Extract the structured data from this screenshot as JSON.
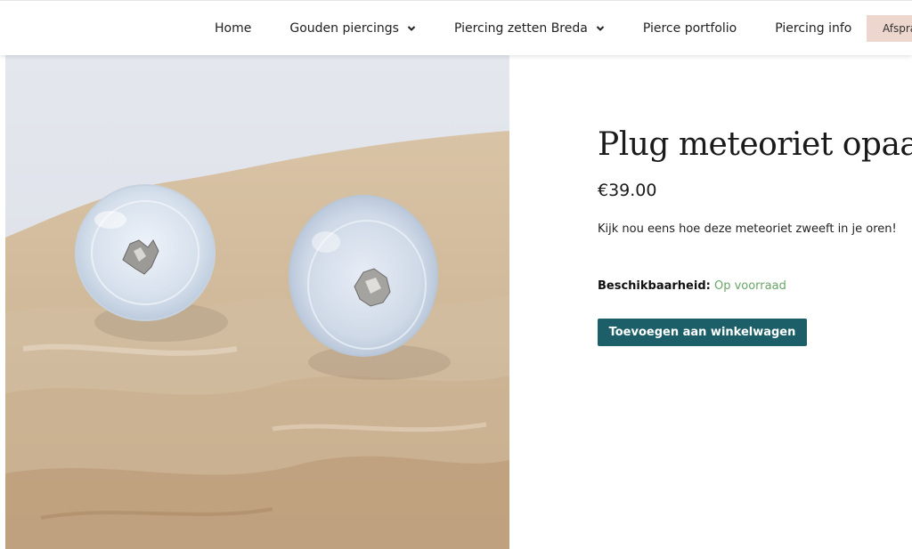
{
  "nav": {
    "items": [
      {
        "label": "Home",
        "dropdown": false
      },
      {
        "label": "Gouden piercings",
        "dropdown": true
      },
      {
        "label": "Piercing zetten Breda",
        "dropdown": true
      },
      {
        "label": "Pierce portfolio",
        "dropdown": false
      },
      {
        "label": "Piercing info",
        "dropdown": false
      }
    ],
    "cta_label": "Afspraak"
  },
  "product": {
    "title": "Plug meteoriet opaal",
    "price": "€39.00",
    "description": "Kijk nou eens hoe deze meteoriet zweeft in je oren!",
    "availability_label": "Beschikbaarheid:",
    "availability_value": "Op voorraad",
    "add_to_cart_label": "Toevoegen aan winkelwagen"
  },
  "colors": {
    "button": "#1d5f68",
    "availability": "#6aa56a",
    "cta": "#ecd6cd"
  }
}
